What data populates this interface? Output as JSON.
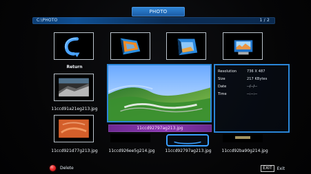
{
  "header": {
    "title": "PHOTO",
    "path": "C:\\PHOTO",
    "page_indicator": "1 / 2"
  },
  "grid": {
    "top_row": [
      {
        "caption": "",
        "icon": "return-arrow-icon"
      },
      {
        "caption": "",
        "icon": "photo-thumb-1"
      },
      {
        "caption": "",
        "icon": "photo-thumb-2"
      },
      {
        "caption": "",
        "icon": "photo-thumb-3"
      }
    ],
    "middle_left": [
      {
        "caption": "Return",
        "icon": "return-label"
      },
      {
        "caption": "11ccd91a21eg213.jpg",
        "icon": "photo-thumb-4"
      }
    ],
    "bottom_row": [
      {
        "caption": "11ccd921d77g213.jpg",
        "icon": "photo-thumb-5"
      },
      {
        "caption": "11ccd926ee5g214.jpg",
        "icon": "photo-thumb-6"
      },
      {
        "caption": "11ccd92797ag213.jpg",
        "icon": "photo-thumb-7"
      },
      {
        "caption": "11ccd92ba90g214.jpg",
        "icon": "photo-thumb-8"
      }
    ]
  },
  "preview": {
    "selected_filename": "11ccd92797ag213.jpg"
  },
  "info_panel": {
    "fields": [
      {
        "label": "Resolution",
        "value": "736 X 487"
      },
      {
        "label": "Size",
        "value": "217 KBytes"
      },
      {
        "label": "Date",
        "value": "--/--/--"
      },
      {
        "label": "Time",
        "value": "--:--:--"
      }
    ]
  },
  "footer": {
    "delete_label": "Delete",
    "exit_key": "EXIT",
    "exit_label": "Exit"
  },
  "colors": {
    "accent_blue": "#2a86d8",
    "selected_bar_purple": "#8b38b2",
    "delete_red": "#e33333"
  }
}
